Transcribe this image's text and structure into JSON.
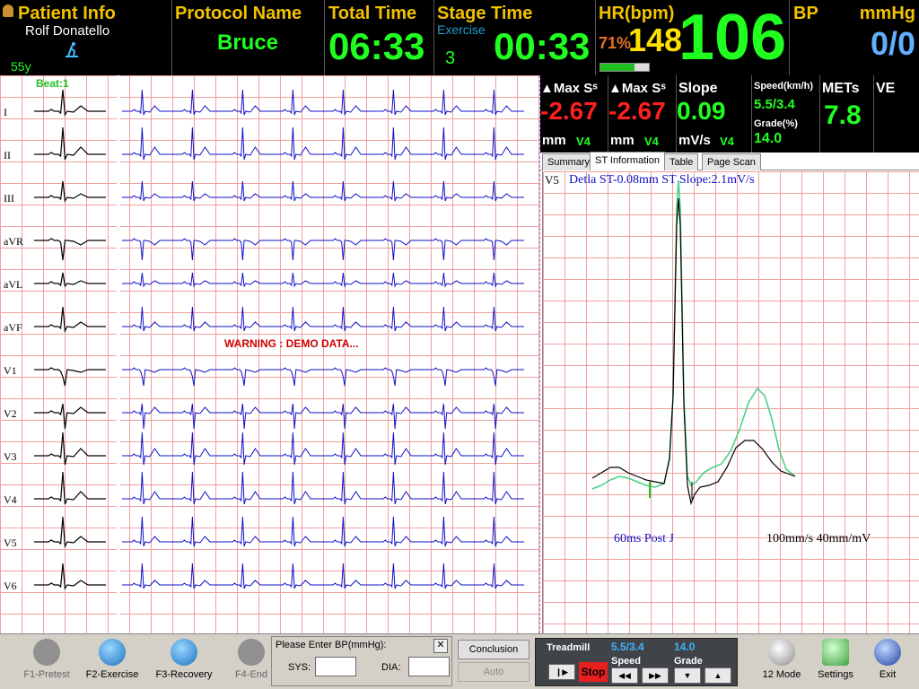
{
  "patient": {
    "header": "Patient Info",
    "name": "Rolf  Donatello",
    "age": "55y"
  },
  "protocol": {
    "header": "Protocol Name",
    "value": "Bruce"
  },
  "total_time": {
    "header": "Total Time",
    "value": "06:33"
  },
  "stage_time": {
    "header": "Stage Time",
    "stage_label": "Exercise",
    "stage_number": "3",
    "value": "00:33"
  },
  "hr": {
    "header": "HR(bpm)",
    "percent": "71%",
    "target": "148",
    "value": "106"
  },
  "bp": {
    "header": "BP",
    "unit": "mmHg",
    "value": "0/0"
  },
  "ecg": {
    "beat_label": "Beat:1",
    "leads": [
      "I",
      "II",
      "III",
      "aVR",
      "aVL",
      "aVF",
      "V1",
      "V2",
      "V3",
      "V4",
      "V5",
      "V6"
    ],
    "warning": "WARNING : DEMO DATA..."
  },
  "st_panel": {
    "max_st1": {
      "label": "▲Max Sˢ",
      "value": "-2.67",
      "unit": "mm",
      "lead": "V4"
    },
    "max_st2": {
      "label": "▲Max Sˢ",
      "value": "-2.67",
      "unit": "mm",
      "lead": "V4"
    },
    "slope": {
      "label": "Slope",
      "value": "0.09",
      "unit": "mV/s",
      "lead": "V4"
    },
    "speed": {
      "label": "Speed(km/h)",
      "value": "5.5/3.4"
    },
    "grade": {
      "label": "Grade(%)",
      "value": "14.0"
    },
    "mets": {
      "label": "METs",
      "value": "7.8"
    },
    "ve": {
      "label": "VE"
    }
  },
  "tabs": [
    "Summary",
    "ST Information",
    "Table",
    "Page Scan"
  ],
  "st_info": {
    "lead": "V5",
    "title": "Detla ST-0.08mm ST Slope:2.1mV/s",
    "post_j": "60ms Post J",
    "scale": "100mm/s 40mm/mV"
  },
  "footer": {
    "f1": "F1-Pretest",
    "f2": "F2-Exercise",
    "f3": "F3-Recovery",
    "f4": "F4-End",
    "bp_prompt": "Please Enter BP(mmHg):",
    "sys_label": "SYS:",
    "dia_label": "DIA:",
    "conclusion": "Conclusion",
    "auto": "Auto",
    "treadmill": "Treadmill",
    "tm_speed_val": "5.5/3.4",
    "tm_grade_val": "14.0",
    "tm_speed_label": "Speed",
    "tm_grade_label": "Grade",
    "stop": "Stop",
    "mode12": "12 Mode",
    "settings": "Settings",
    "exit": "Exit"
  },
  "colors": {
    "header_bg": "#000000",
    "yellow": "#f2c200",
    "green": "#20ff20",
    "red": "#ff2020",
    "ecg_blue": "#1010c8",
    "grid": "#f0a0a0"
  }
}
